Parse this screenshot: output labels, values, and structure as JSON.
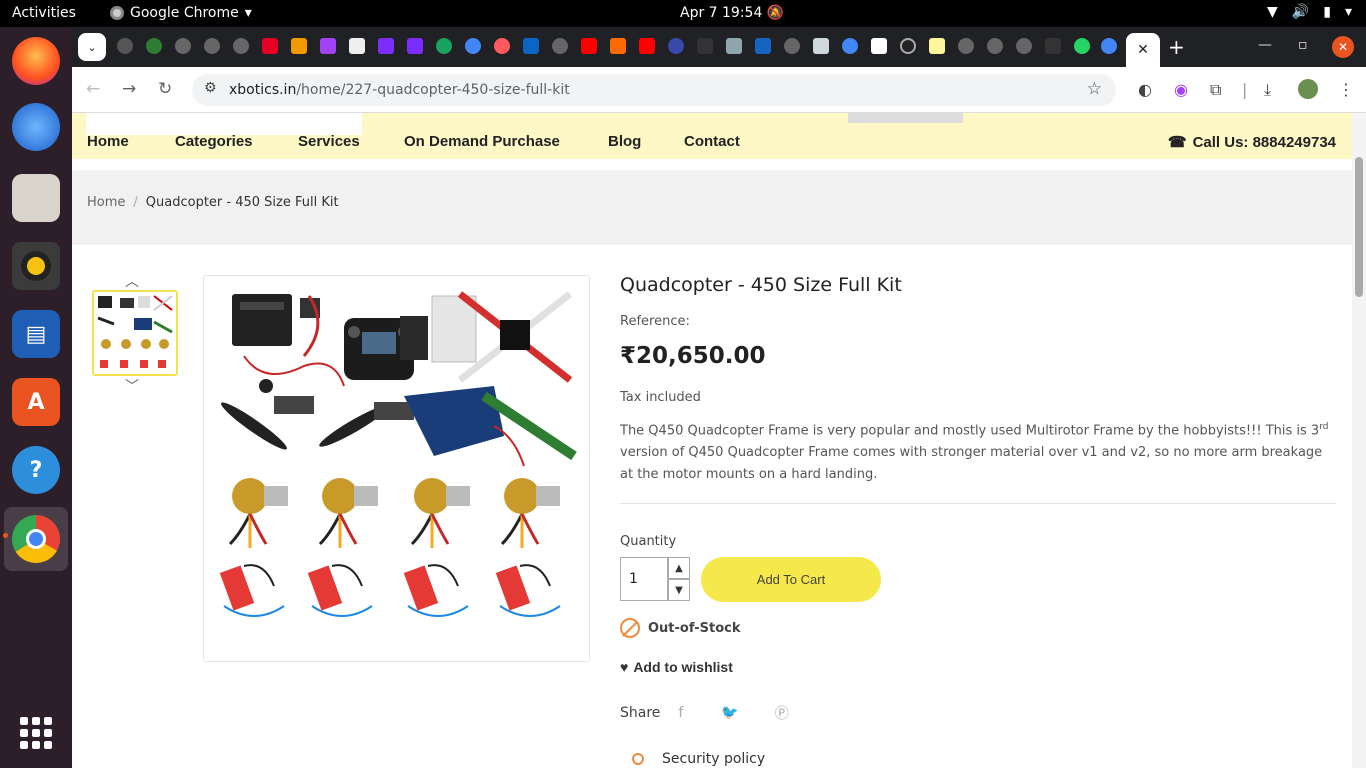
{
  "system": {
    "activities": "Activities",
    "app_name": "Google Chrome",
    "clock": "Apr 7  19:54"
  },
  "browser": {
    "url_host": "xbotics.in",
    "url_path": "/home/227-quadcopter-450-size-full-kit"
  },
  "site_nav": {
    "items": [
      "Home",
      "Categories",
      "Services",
      "On Demand Purchase",
      "Blog",
      "Contact"
    ],
    "call_us": "Call Us: 8884249734"
  },
  "breadcrumb": {
    "home": "Home",
    "separator": "/",
    "current": "Quadcopter - 450 Size Full Kit"
  },
  "product": {
    "title": "Quadcopter - 450 Size Full Kit",
    "reference_label": "Reference:",
    "price": "₹20,650.00",
    "tax_note": "Tax included",
    "description_part1": "The Q450 Quadcopter Frame is very popular and mostly used Multirotor Frame by the hobbyists!!! This is 3",
    "description_sup": "rd",
    "description_part2": " version of Q450 Quadcopter Frame comes with stronger material over v1 and v2, so no more arm breakage at the motor mounts on a hard landing.",
    "quantity_label": "Quantity",
    "quantity_value": "1",
    "add_to_cart": "Add To Cart",
    "stock_status": "Out-of-Stock",
    "wishlist": "Add to wishlist",
    "share_label": "Share",
    "security_policy": "Security policy"
  },
  "colors": {
    "nav_bg": "#fdf8c6",
    "accent_yellow": "#f5e84b",
    "out_of_stock": "#f08a3c",
    "dock_bg": "#2c1f29"
  }
}
